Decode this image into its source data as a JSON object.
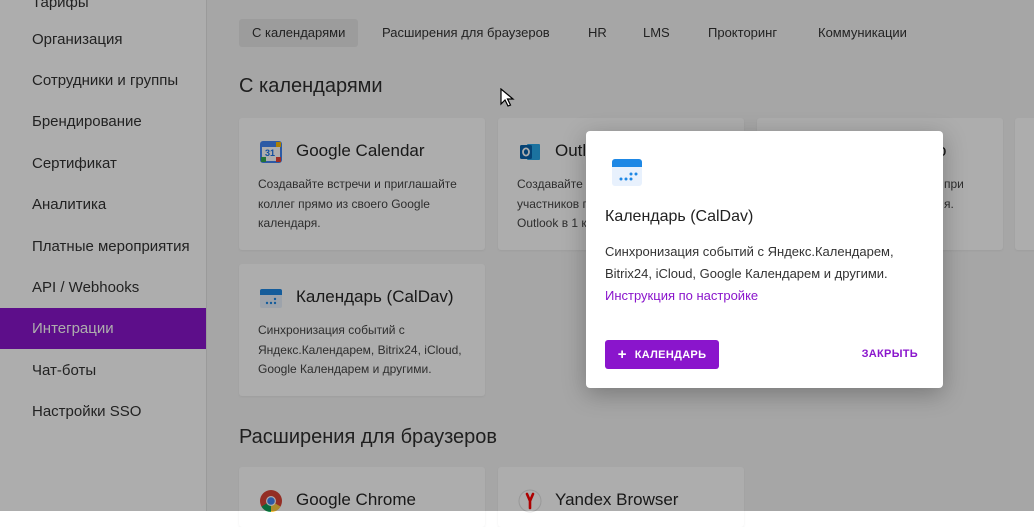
{
  "sidebar": {
    "items": [
      {
        "label": "Тарифы"
      },
      {
        "label": "Организация"
      },
      {
        "label": "Сотрудники и группы"
      },
      {
        "label": "Брендирование"
      },
      {
        "label": "Сертификат"
      },
      {
        "label": "Аналитика"
      },
      {
        "label": "Платные мероприятия"
      },
      {
        "label": "API / Webhooks"
      },
      {
        "label": "Интеграции"
      },
      {
        "label": "Чат-боты"
      },
      {
        "label": "Настройки SSO"
      }
    ]
  },
  "tabs": [
    {
      "label": "С календарями"
    },
    {
      "label": "Расширения для браузеров"
    },
    {
      "label": "HR"
    },
    {
      "label": "LMS"
    },
    {
      "label": "Прокторинг"
    },
    {
      "label": "Коммуникации"
    }
  ],
  "sections": {
    "calendars": "С календарями",
    "browsers": "Расширения для браузеров"
  },
  "cards": {
    "google": {
      "title": "Google Calendar",
      "desc": "Создавайте встречи и приглашайте коллег прямо из своего Google календаря.",
      "icon_day": "31"
    },
    "outlook": {
      "title": "Outl",
      "desc": "Создавайте в участников п Outlook в 1 к"
    },
    "third": {
      "title": "о",
      "desc_line1": "при",
      "desc_line2": "я."
    },
    "caldav": {
      "title": "Календарь (CalDav)",
      "desc": "Синхронизация событий с Яндекс.Календарем, Bitrix24, iCloud, Google Календарем и другими."
    },
    "chrome": {
      "title": "Google Chrome"
    },
    "yandex": {
      "title": "Yandex Browser"
    }
  },
  "dialog": {
    "title": "Календарь (CalDav)",
    "desc": "Синхронизация событий с Яндекс.Календарем, Bitrix24, iCloud, Google Календарем и другими.",
    "link": "Инструкция по настройке",
    "add_button": "КАЛЕНДАРЬ",
    "close_button": "ЗАКРЫТЬ"
  },
  "colors": {
    "accent": "#8a15cc",
    "calendar_blue": "#1e88e5"
  }
}
